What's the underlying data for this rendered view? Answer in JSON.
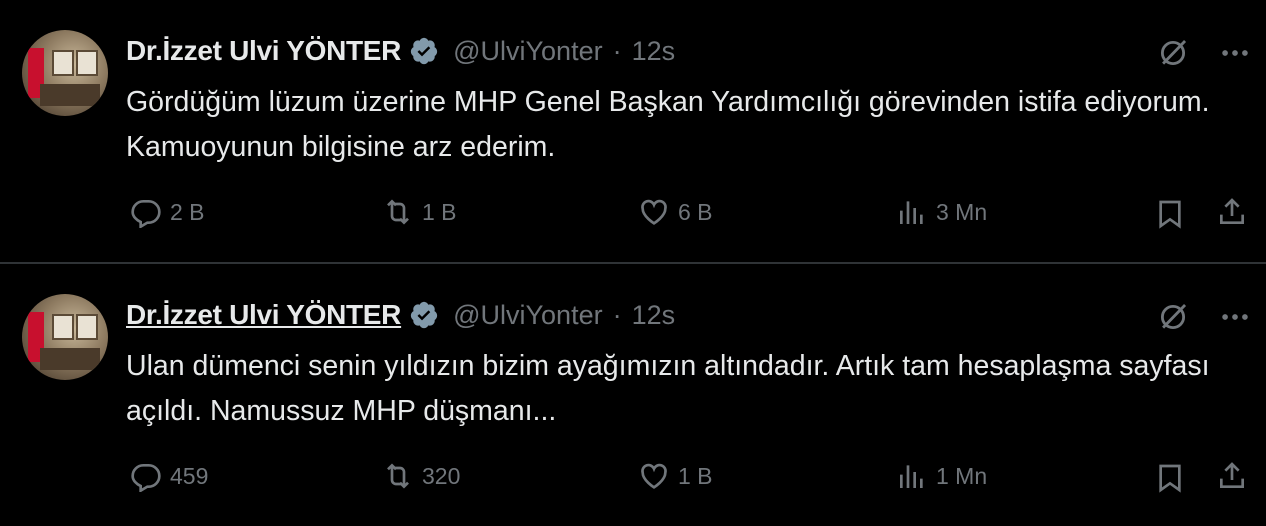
{
  "tweets": [
    {
      "author_name": "Dr.İzzet Ulvi YÖNTER",
      "handle": "@UlviYonter",
      "separator": "·",
      "time": "12s",
      "text": "Gördüğüm lüzum üzerine MHP Genel Başkan Yardımcılığı görevinden istifa ediyorum. Kamuoyunun bilgisine arz ederim.",
      "replies": "2 B",
      "retweets": "1 B",
      "likes": "6 B",
      "views": "3 Mn"
    },
    {
      "author_name": "Dr.İzzet Ulvi YÖNTER",
      "handle": "@UlviYonter",
      "separator": "·",
      "time": "12s",
      "text": "Ulan dümenci senin yıldızın bizim ayağımızın altındadır. Artık tam hesaplaşma sayfası açıldı. Namussuz MHP düşmanı...",
      "replies": "459",
      "retweets": "320",
      "likes": "1 B",
      "views": "1 Mn"
    }
  ],
  "icons": [
    "avatar",
    "verified-badge-icon",
    "grok-icon",
    "more-icon",
    "reply-icon",
    "retweet-icon",
    "like-icon",
    "views-icon",
    "bookmark-icon",
    "share-icon"
  ],
  "colors": {
    "background": "#000000",
    "text": "#e7e9ea",
    "muted": "#71767b",
    "verified": "#829aab",
    "divider": "#2f3336"
  }
}
